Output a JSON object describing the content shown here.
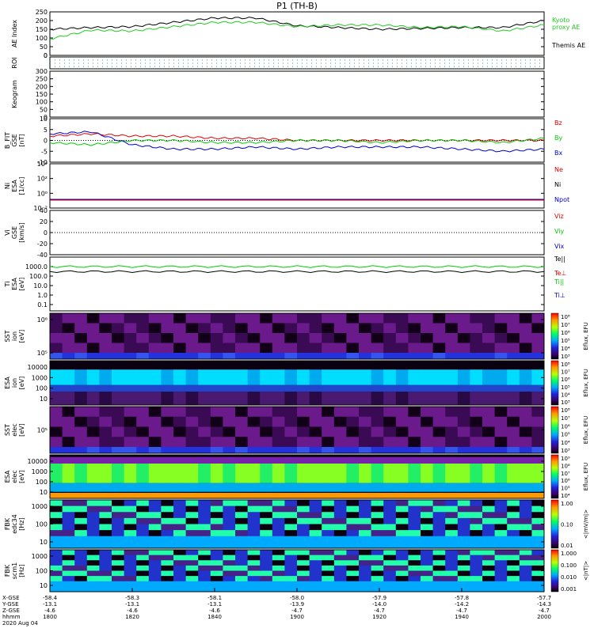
{
  "title": "P1 (TH-B)",
  "colors": {
    "black": "#000000",
    "red": "#dd0000",
    "green": "#00cc00",
    "blue": "#0000cc",
    "kyoto": "#22cc22"
  },
  "panels": {
    "ae": {
      "ylabel": "AE Index",
      "ticks": [
        "250",
        "200",
        "150",
        "100",
        "50",
        "0"
      ],
      "legend_kyoto": "Kyoto\nproxy AE",
      "legend_themis": "Themis AE"
    },
    "roi": {
      "ylabel": "ROI",
      "ticks": [
        "0"
      ]
    },
    "keogram": {
      "ylabel": "Keogram",
      "ticks": [
        "300",
        "250",
        "200",
        "150",
        "100",
        "50",
        "0"
      ]
    },
    "bfit": {
      "ylabel_lines": [
        "B_FIT",
        "GSE",
        "[nT]"
      ],
      "ticks": [
        "10",
        "5",
        "0",
        "-5",
        "-10"
      ],
      "legend": [
        "Bz",
        "By",
        "Bx"
      ]
    },
    "ni": {
      "ylabel_lines": [
        "Ni",
        "ESA",
        "[1/cc]"
      ],
      "ticks": [
        "10⁴",
        "10²",
        "10⁰",
        "10⁻²"
      ],
      "legend": [
        "Ne",
        "Ni",
        "Npot"
      ]
    },
    "vi": {
      "ylabel_lines": [
        "Vi",
        "GSE",
        "[km/s]"
      ],
      "ticks": [
        "40",
        "20",
        "0",
        "-20",
        "-40"
      ],
      "legend": [
        "Viz",
        "Viy",
        "Vix"
      ]
    },
    "ti": {
      "ylabel_lines": [
        "Ti",
        "ESA",
        "[eV]"
      ],
      "ticks": [
        "1000.0",
        "100.0",
        "10.0",
        "1.0",
        "0.1"
      ],
      "legend": [
        "Te||",
        "Te⊥",
        "Ti||",
        "Ti⊥"
      ]
    },
    "sst_i": {
      "ylabel_lines": [
        "SST",
        "ion",
        "[eV]"
      ],
      "ticks": [
        "10⁶",
        "10⁵"
      ],
      "cbar_ticks": [
        "10⁸",
        "10⁷",
        "10⁶",
        "10⁵",
        "10⁴",
        "10³"
      ],
      "cbar_label": "Eflux, EFU"
    },
    "esa_i": {
      "ylabel_lines": [
        "ESA",
        "ion",
        "[eV]"
      ],
      "ticks": [
        "10000",
        "1000",
        "100",
        "10"
      ],
      "cbar_ticks": [
        "10⁸",
        "10⁷",
        "10⁶",
        "10⁵",
        "10⁴",
        "10³"
      ],
      "cbar_label": "Eflux, EFU"
    },
    "sst_e": {
      "ylabel_lines": [
        "SST",
        "elec",
        "[eV]"
      ],
      "ticks": [
        "10⁵"
      ],
      "cbar_ticks": [
        "10⁸",
        "10⁷",
        "10⁶",
        "10⁵",
        "10⁴",
        "10³"
      ],
      "cbar_label": "Eflux, EFU"
    },
    "esa_e": {
      "ylabel_lines": [
        "ESA",
        "elec",
        "[eV]"
      ],
      "ticks": [
        "10000",
        "1000",
        "100",
        "10"
      ],
      "cbar_ticks": [
        "10⁹",
        "10⁸",
        "10⁷",
        "10⁶",
        "10⁵",
        "10⁴"
      ],
      "cbar_label": "Eflux, EFU"
    },
    "fbk_e": {
      "ylabel_lines": [
        "FBK",
        "edc34",
        "[Hz]"
      ],
      "ticks": [
        "1000",
        "100",
        "10"
      ],
      "cbar_ticks": [
        "1.00",
        "0.10",
        "0.01"
      ],
      "cbar_label": "<|mV/m|>"
    },
    "fbk_b": {
      "ylabel_lines": [
        "FBK",
        "scm1",
        "[Hz]"
      ],
      "ticks": [
        "1000",
        "100",
        "10"
      ],
      "cbar_ticks": [
        "1.000",
        "0.100",
        "0.010",
        "0.001"
      ],
      "cbar_label": "<|nT|>"
    }
  },
  "xaxis": {
    "row_labels": [
      "X-GSE",
      "Y-GSE",
      "Z-GSE",
      "hhmm",
      "2020 Aug 04"
    ],
    "columns": [
      {
        "x": "-58.4",
        "y": "-13.1",
        "z": "-4.6",
        "t": "1800"
      },
      {
        "x": "-58.3",
        "y": "-13.1",
        "z": "-4.6",
        "t": "1820"
      },
      {
        "x": "-58.1",
        "y": "-13.1",
        "z": "-4.6",
        "t": "1840"
      },
      {
        "x": "-58.0",
        "y": "-13.9",
        "z": "-4.7",
        "t": "1900"
      },
      {
        "x": "-57.9",
        "y": "-14.0",
        "z": "-4.7",
        "t": "1920"
      },
      {
        "x": "-57.8",
        "y": "-14.2",
        "z": "-4.7",
        "t": "1940"
      },
      {
        "x": "-57.7",
        "y": "-14.3",
        "z": "-4.7",
        "t": "2000"
      }
    ]
  },
  "chart_data": [
    {
      "type": "line",
      "panel": "AE Index",
      "x": [
        "1800",
        "1810",
        "1820",
        "1830",
        "1840",
        "1850",
        "1900",
        "1910",
        "1920",
        "1930",
        "1940",
        "1950",
        "2000"
      ],
      "series": [
        {
          "name": "Themis AE",
          "values": [
            150,
            160,
            165,
            190,
            215,
            215,
            170,
            160,
            150,
            155,
            160,
            160,
            200
          ]
        },
        {
          "name": "Kyoto proxy AE",
          "values": [
            95,
            145,
            140,
            165,
            190,
            190,
            165,
            175,
            175,
            160,
            165,
            140,
            175
          ]
        }
      ],
      "ylim": [
        0,
        250
      ]
    },
    {
      "type": "line",
      "panel": "B_FIT GSE [nT]",
      "x": [
        "1800",
        "1810",
        "1820",
        "1830",
        "1840",
        "1850",
        "1900",
        "1910",
        "1920",
        "1930",
        "1940",
        "1950",
        "2000"
      ],
      "series": [
        {
          "name": "Bz",
          "values": [
            2,
            3,
            2,
            2,
            1,
            1,
            0,
            0,
            0,
            0,
            0,
            0,
            0
          ]
        },
        {
          "name": "By",
          "values": [
            -1,
            -2,
            0,
            0,
            -1,
            -1,
            0,
            0,
            -1,
            0,
            0,
            -1,
            1
          ]
        },
        {
          "name": "Bx",
          "values": [
            3,
            4,
            -2,
            -4,
            -4,
            -3,
            -4,
            -3,
            -3,
            -3,
            -4,
            -5,
            -4
          ]
        }
      ],
      "ylim": [
        -10,
        10
      ]
    },
    {
      "type": "line",
      "panel": "Ti ESA [eV]",
      "x": [
        "1800",
        "1820",
        "1840",
        "1900",
        "1920",
        "1940",
        "2000"
      ],
      "series": [
        {
          "name": "Te||",
          "values": [
            1000,
            1000,
            1000,
            1000,
            1000,
            1000,
            1000
          ]
        },
        {
          "name": "Ti||",
          "values": [
            300,
            300,
            300,
            300,
            300,
            300,
            300
          ]
        }
      ],
      "ylim": [
        0.1,
        1000
      ]
    },
    {
      "type": "heatmap",
      "panel": "SST / ESA / FBK spectrograms",
      "x": [
        "1800",
        "1820",
        "1840",
        "1900",
        "1920",
        "1940",
        "2000"
      ],
      "note_bands": [
        "SST ion",
        "ESA ion",
        "SST elec",
        "ESA elec",
        "FBK edc34",
        "FBK scm1"
      ]
    }
  ]
}
